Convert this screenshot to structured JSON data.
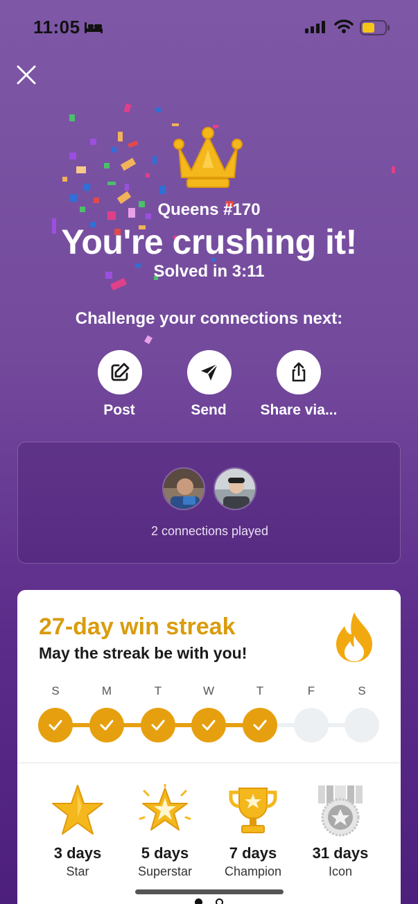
{
  "status_bar": {
    "time": "11:05",
    "focus_icon": "bed-icon",
    "signal_icon": "cellular-signal-icon",
    "wifi_icon": "wifi-icon",
    "battery_icon": "battery-icon",
    "battery_color": "#f5c518",
    "battery_level": 0.55
  },
  "header": {
    "close_icon": "close-icon"
  },
  "result": {
    "puzzle_name": "Queens #170",
    "headline": "You're crushing it!",
    "solved_text": "Solved in 3:11",
    "crown_icon": "crown-icon"
  },
  "share": {
    "prompt": "Challenge your connections next:",
    "buttons": [
      {
        "label": "Post",
        "icon": "pencil-edit-icon"
      },
      {
        "label": "Send",
        "icon": "paper-plane-icon"
      },
      {
        "label": "Share via...",
        "icon": "share-upload-icon"
      }
    ]
  },
  "connections": {
    "text": "2 connections played",
    "avatar_count": 2
  },
  "streak": {
    "title": "27-day win streak",
    "subtitle": "May the streak be with you!",
    "accent_color": "#e6a00f",
    "days": [
      {
        "letter": "S",
        "completed": true
      },
      {
        "letter": "M",
        "completed": true
      },
      {
        "letter": "T",
        "completed": true
      },
      {
        "letter": "W",
        "completed": true
      },
      {
        "letter": "T",
        "completed": true
      },
      {
        "letter": "F",
        "completed": false
      },
      {
        "letter": "S",
        "completed": false
      }
    ],
    "badges": [
      {
        "days": "3 days",
        "name": "Star",
        "icon": "star-badge-icon"
      },
      {
        "days": "5 days",
        "name": "Superstar",
        "icon": "superstar-badge-icon"
      },
      {
        "days": "7 days",
        "name": "Champion",
        "icon": "trophy-badge-icon"
      },
      {
        "days": "31 days",
        "name": "Icon",
        "icon": "silver-medal-badge-icon"
      }
    ]
  },
  "pagination": {
    "current_page": 1,
    "total_pages": 2
  }
}
